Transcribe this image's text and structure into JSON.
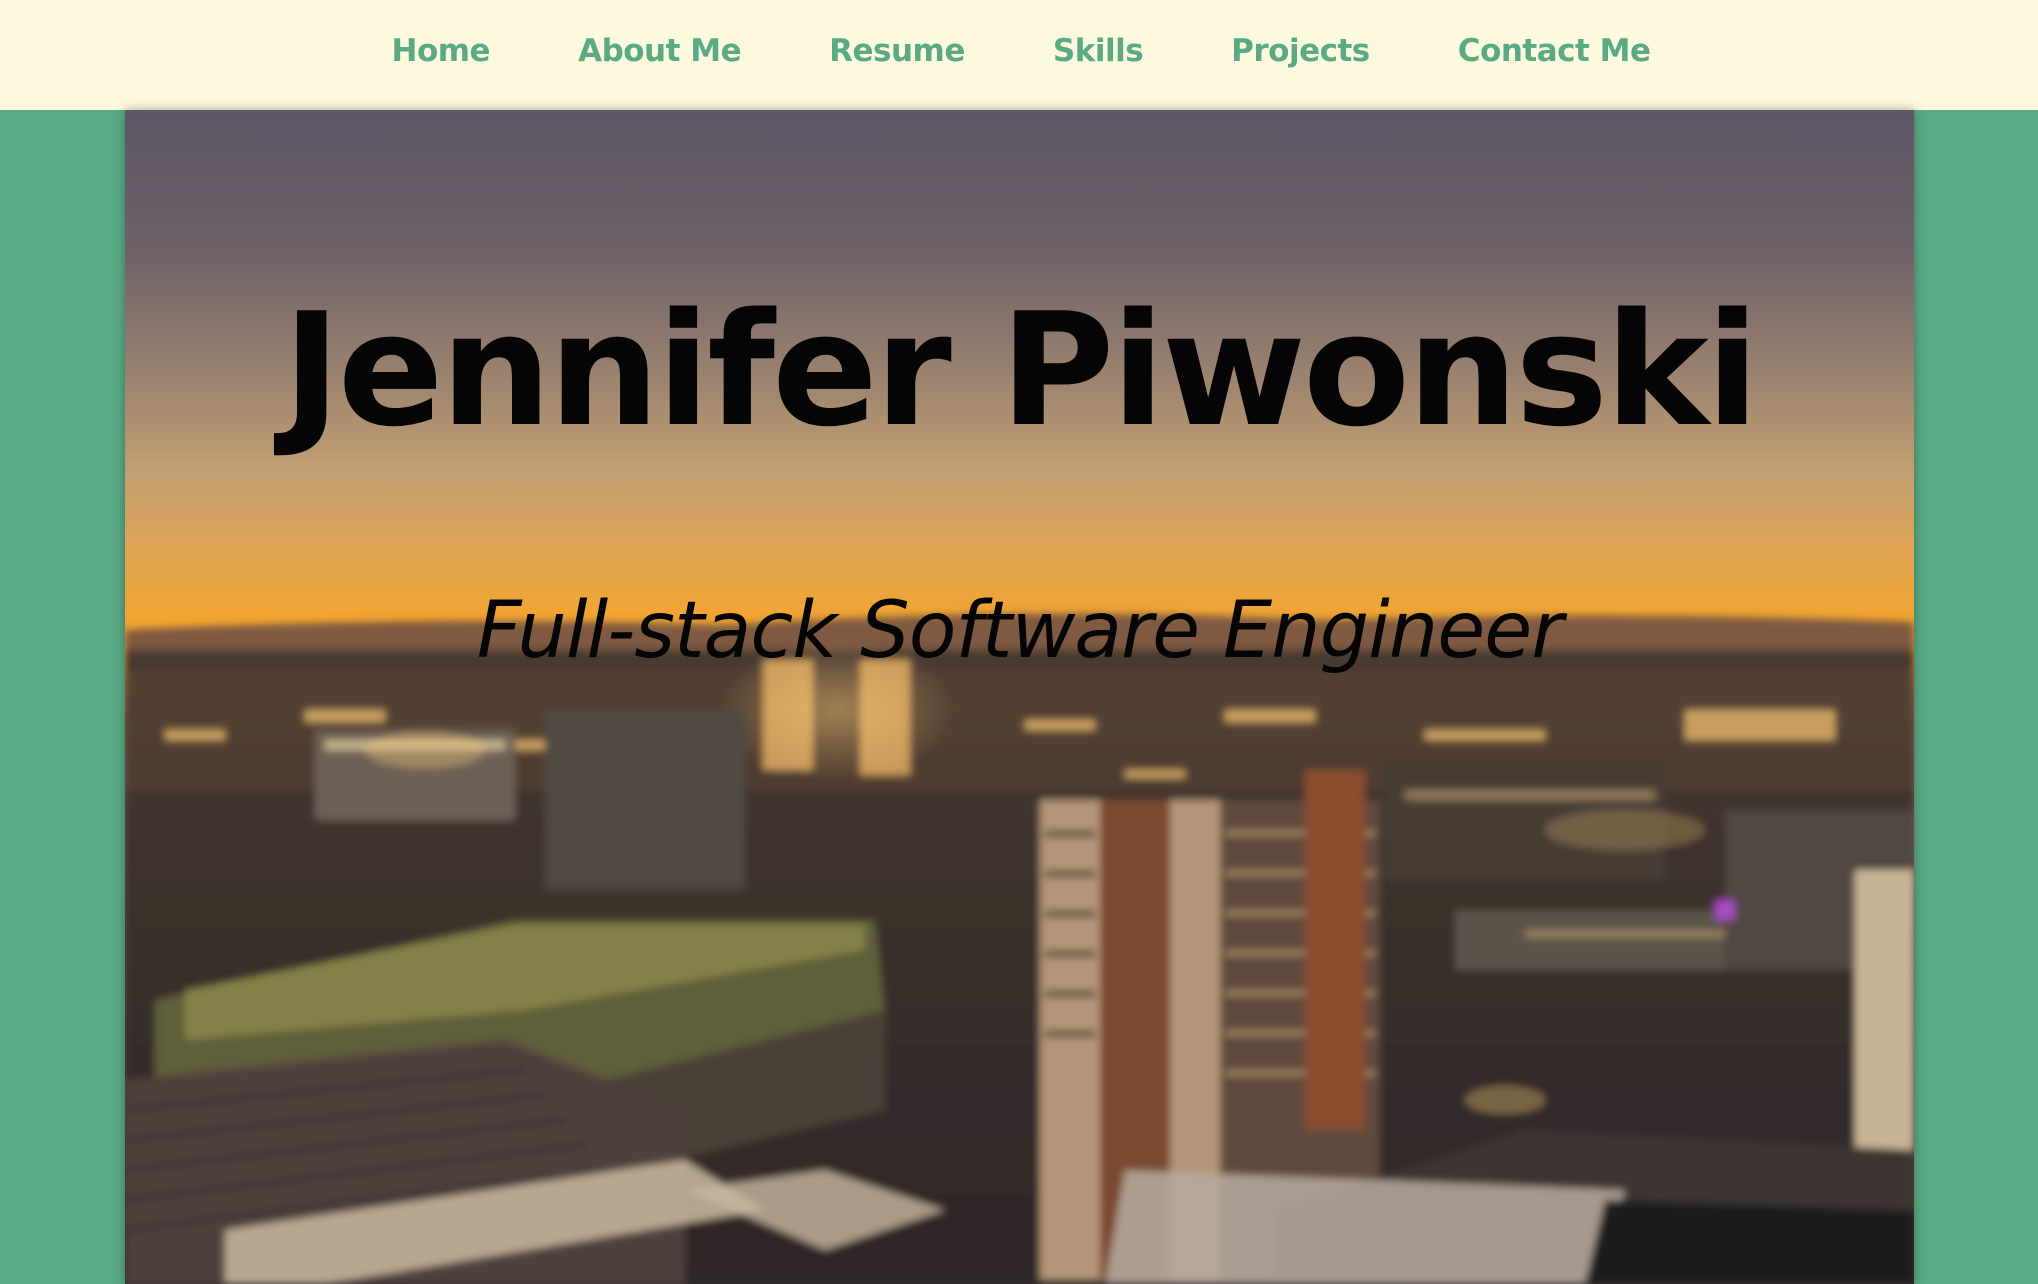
{
  "nav": {
    "items": [
      {
        "label": "Home"
      },
      {
        "label": "About Me"
      },
      {
        "label": "Resume"
      },
      {
        "label": "Skills"
      },
      {
        "label": "Projects"
      },
      {
        "label": "Contact Me"
      }
    ]
  },
  "hero": {
    "title": "Jennifer Piwonski",
    "subtitle": "Full-stack Software Engineer",
    "image": "city-skyline-sunset-photo"
  },
  "colors": {
    "page_background": "#5aaa86",
    "navbar_background": "#fdf9de",
    "nav_link": "#5aaa86",
    "hero_text": "#050505"
  }
}
